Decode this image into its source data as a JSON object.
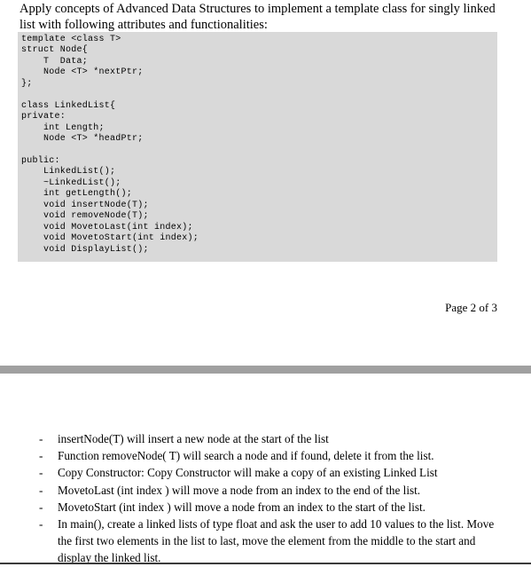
{
  "document": {
    "page_one": {
      "heading": "Apply concepts of Advanced Data Structures to implement a template class for singly linked list with following attributes and functionalities:",
      "code_block": "template <class T>\nstruct Node{\n    T  Data;\n    Node <T> *nextPtr;\n};\n\nclass LinkedList{\nprivate:\n    int Length;\n    Node <T> *headPtr;\n\npublic:\n    LinkedList();\n    ~LinkedList();\n    int getLength();\n    void insertNode(T);\n    void removeNode(T);\n    void MovetoLast(int index);\n    void MovetoStart(int index);\n    void DisplayList();\n\n};",
      "footer": "Page 2 of 3"
    },
    "page_two": {
      "bullets": [
        {
          "marker": "-",
          "text": "insertNode(T) will insert a new node at the start of the list"
        },
        {
          "marker": "-",
          "text": "Function removeNode( T) will search a node and if found, delete it from the list."
        },
        {
          "marker": "-",
          "text": "Copy Constructor: Copy Constructor will make a copy of an existing Linked List"
        },
        {
          "marker": "-",
          "text": "MovetoLast (int index ) will move a node from an index to the end of the list."
        },
        {
          "marker": "-",
          "text": "MovetoStart (int index ) will move a node from an index to the start of the list."
        },
        {
          "marker": "-",
          "text": "In main(),  create a linked lists of type float and ask the user to add 10 values to the list. Move the first two elements in the list to last, move the element from the middle to the start and display the linked list."
        }
      ]
    }
  },
  "colors": {
    "code_background": "#d9d9d9",
    "separator": "#a0a0a0",
    "page_background": "#ffffff",
    "text": "#000000"
  }
}
